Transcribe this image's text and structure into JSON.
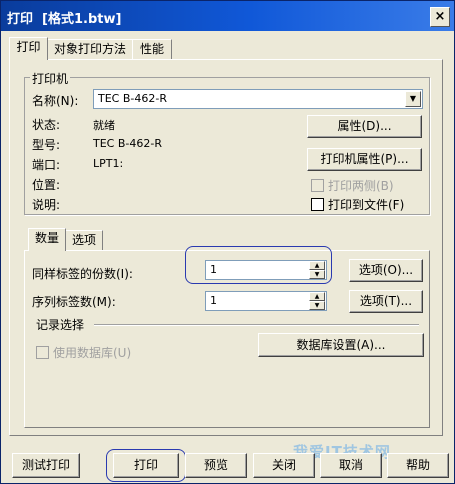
{
  "window": {
    "title": "打印  [格式1.btw]",
    "close_glyph": "×"
  },
  "tabs": [
    {
      "label": "打印",
      "active": true
    },
    {
      "label": "对象打印方法",
      "active": false
    },
    {
      "label": "性能",
      "active": false
    }
  ],
  "printer": {
    "group_title": "打印机",
    "name_label": "名称(N):",
    "name_value": "TEC B-462-R",
    "status_label": "状态:",
    "status_value": "就绪",
    "type_label": "型号:",
    "type_value": "TEC B-462-R",
    "port_label": "端口:",
    "port_value": "LPT1:",
    "location_label": "位置:",
    "comment_label": "说明:",
    "properties_button": "属性(D)...",
    "printer_properties_button": "打印机属性(P)...",
    "duplex_checkbox": "打印两侧(B)",
    "print_to_file_checkbox": "打印到文件(F)"
  },
  "subtabs": [
    {
      "label": "数量",
      "active": true
    },
    {
      "label": "选项",
      "active": false
    }
  ],
  "quantity": {
    "copies_label": "同样标签的份数(I):",
    "copies_value": "1",
    "copies_options_button": "选项(O)...",
    "serial_label": "序列标签数(M):",
    "serial_value": "1",
    "serial_options_button": "选项(T)...",
    "record_selection_label": "记录选择",
    "use_database_checkbox": "使用数据库(U)",
    "database_setup_button": "数据库设置(A)..."
  },
  "footer": {
    "test_print": "测试打印",
    "print": "打印",
    "preview": "预览",
    "close": "关闭",
    "cancel": "取消",
    "help": "帮助"
  },
  "watermark": {
    "text": "我爱IT技术网"
  },
  "colors": {
    "title_bar": "#1058d8",
    "highlight_ring": "#2a3ab0",
    "dialog_bg": "#ece9d8"
  }
}
